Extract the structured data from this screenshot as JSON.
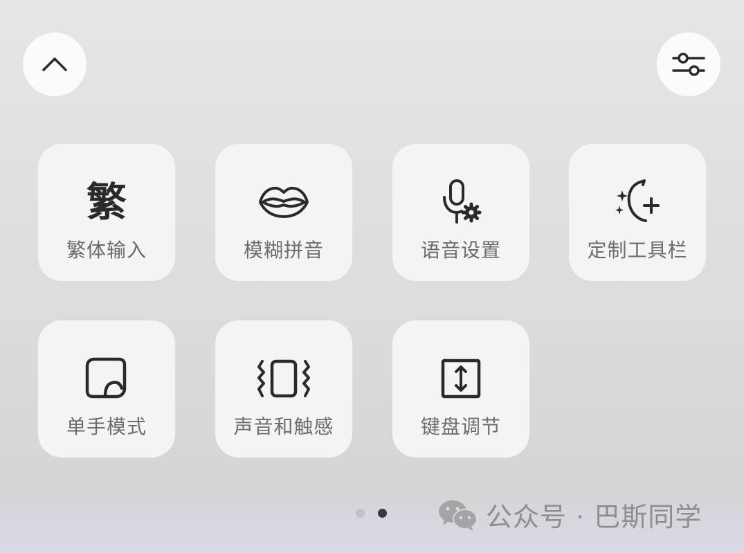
{
  "header": {
    "collapse_icon": "chevron-up-icon",
    "settings_icon": "sliders-icon"
  },
  "tiles": [
    {
      "label": "繁体输入",
      "icon": "traditional-char-icon",
      "glyph": "繁"
    },
    {
      "label": "模糊拼音",
      "icon": "lips-icon"
    },
    {
      "label": "语音设置",
      "icon": "mic-gear-icon"
    },
    {
      "label": "定制工具栏",
      "icon": "moon-sparkle-plus-icon"
    },
    {
      "label": "单手模式",
      "icon": "one-hand-icon"
    },
    {
      "label": "声音和触感",
      "icon": "vibrate-icon"
    },
    {
      "label": "键盘调节",
      "icon": "resize-vertical-icon"
    }
  ],
  "pagination": {
    "current_page": 2,
    "total_pages": 2
  },
  "watermark": {
    "text": "公众号 · 巴斯同学",
    "icon": "wechat-icon"
  },
  "colors": {
    "tile_background": "#f4f4f6",
    "icon": "#2a2a2e",
    "label": "#6b6b70"
  }
}
